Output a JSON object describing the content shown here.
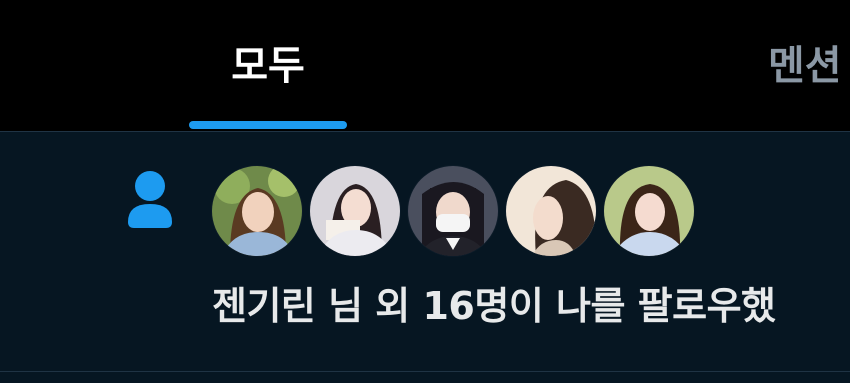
{
  "tabs": [
    {
      "label": "모두",
      "selected": true
    },
    {
      "label": "멘션",
      "selected": false
    }
  ],
  "notification": {
    "icon": "person-icon",
    "text": "젠기린 님 외 16명이 나를 팔로우했",
    "avatars": [
      {
        "name": "follower-avatar-1"
      },
      {
        "name": "follower-avatar-2"
      },
      {
        "name": "follower-avatar-3"
      },
      {
        "name": "follower-avatar-4"
      },
      {
        "name": "follower-avatar-5"
      }
    ]
  },
  "colors": {
    "accent": "#1d9bf0",
    "background": "#000000",
    "row_background": "#061622",
    "text_primary": "#e7e9ea",
    "text_secondary": "#8b98a5"
  }
}
